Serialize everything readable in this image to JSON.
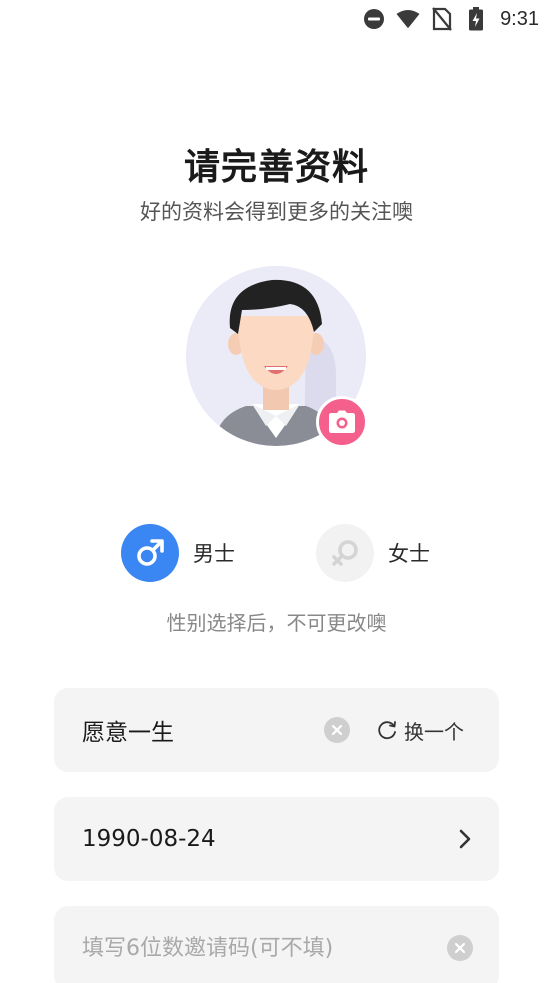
{
  "status_bar": {
    "time": "9:31",
    "icons": [
      "do-not-disturb-icon",
      "wifi-icon",
      "no-sim-icon",
      "battery-charging-icon"
    ]
  },
  "header": {
    "title": "请完善资料",
    "subtitle": "好的资料会得到更多的关注噢"
  },
  "avatar": {
    "icon": "camera-icon",
    "accent": "#f4608b"
  },
  "gender": {
    "options": [
      {
        "label": "男士",
        "icon": "male-icon",
        "selected": true,
        "color": "#3a86f2"
      },
      {
        "label": "女士",
        "icon": "female-icon",
        "selected": false,
        "color": "#f2f2f2"
      }
    ],
    "note": "性别选择后，不可更改噢"
  },
  "form": {
    "nickname": {
      "value": "愿意一生",
      "swap_label": "换一个"
    },
    "birthday": {
      "value": "1990-08-24"
    },
    "invite_code": {
      "value": "",
      "placeholder": "填写6位数邀请码(可不填)"
    }
  }
}
